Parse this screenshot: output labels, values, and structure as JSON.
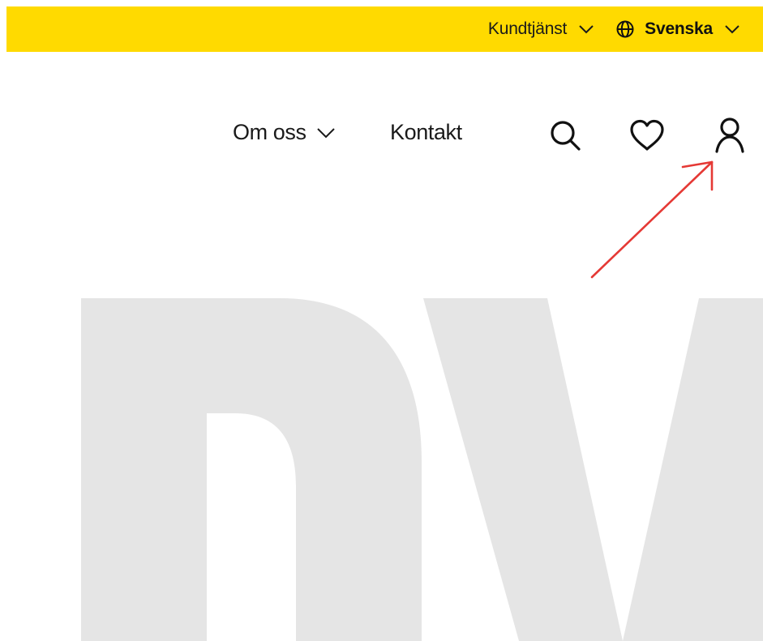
{
  "topbar": {
    "background": "#FFDA00",
    "support_label": "Kundtjänst",
    "language_label": "Svenska",
    "icons": {
      "support_chevron": "chevron-down-icon",
      "globe": "globe-icon",
      "language_chevron": "chevron-down-icon"
    }
  },
  "nav": {
    "about_label": "Om oss",
    "contact_label": "Kontakt",
    "icons": {
      "about_chevron": "chevron-down-icon",
      "search": "search-icon",
      "favorites": "heart-icon",
      "account": "user-icon"
    }
  },
  "annotation": {
    "type": "arrow",
    "color": "#E53935",
    "target": "account icon"
  },
  "hero": {
    "logo_letters_color": "#E5E5E5"
  }
}
